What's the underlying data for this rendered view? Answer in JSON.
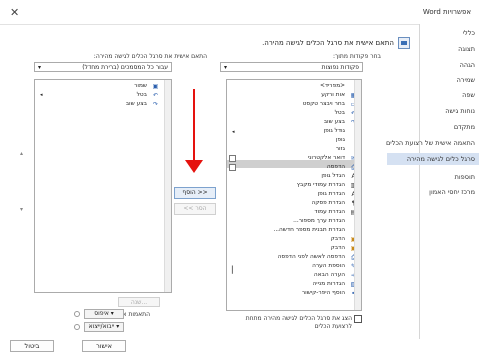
{
  "window": {
    "title": "אפשרויות Word",
    "close": "✕"
  },
  "sidebar": {
    "items": [
      "כללי",
      "תצוגה",
      "הגהה",
      "שמירה",
      "שפה",
      "נוחות גישה",
      "מתקדם",
      "התאמה אישית של רצועת הכלים",
      "סרגל כלים לגישה מהירה",
      "תוספות",
      "מרכז יחסי האמון"
    ]
  },
  "header": {
    "title": "התאם אישית את סרגל הכלים לגישה מהירה."
  },
  "left_panel": {
    "choose_label": "בחר פקודות מתוך:",
    "choose_value": "פקודות נפוצות",
    "commands": [
      "<מפריד>",
      "אות ורקע",
      "בחר ויבצר טקסט",
      "בטל",
      "בצע שוב",
      "גודל גופן",
      "גופן",
      "גזור",
      "דואר אלקטרוני",
      "הדפסה",
      "הגדל גופן",
      "הגדרת עמודי מקבץ",
      "הגדרת גופן",
      "הגדרת פסקה",
      "הגדרת עמוד",
      "הגדרת ערך מספור...",
      "הגדרת תבנית מספר חדשה...",
      "הדבק",
      "הדבק",
      "הדפסה לאשה לפני הדפסה",
      "הוספת הערה",
      "הערה הבאה",
      "הגדרות מנייה",
      "הוסף היפר-קישור"
    ],
    "separate_checkbox": "הצג את סרגל הכלים לגישה מהירה מתחת לרצועת הכלים"
  },
  "buttons": {
    "add": "הוסף >>",
    "remove": "<< הסר",
    "modify": "שנה...",
    "ok": "אישור",
    "cancel": "ביטול"
  },
  "right_panel": {
    "customize_label": "התאם אישית את סרגל הכלים לגישה מהירה:",
    "customize_value": "עבור כל המסמכים (ברירת מחדל)",
    "items": [
      "שמור",
      "בטל",
      "בצע שוב"
    ]
  },
  "customizations": {
    "label": "התאמות אישיות:",
    "reset": "איפוס",
    "import_export": "ייבוא/ייצוא"
  },
  "icons": {
    "accent_red": "#e5120e",
    "selected_bg": "#d5e1f2",
    "highlight_bg": "#cfcfcf"
  }
}
